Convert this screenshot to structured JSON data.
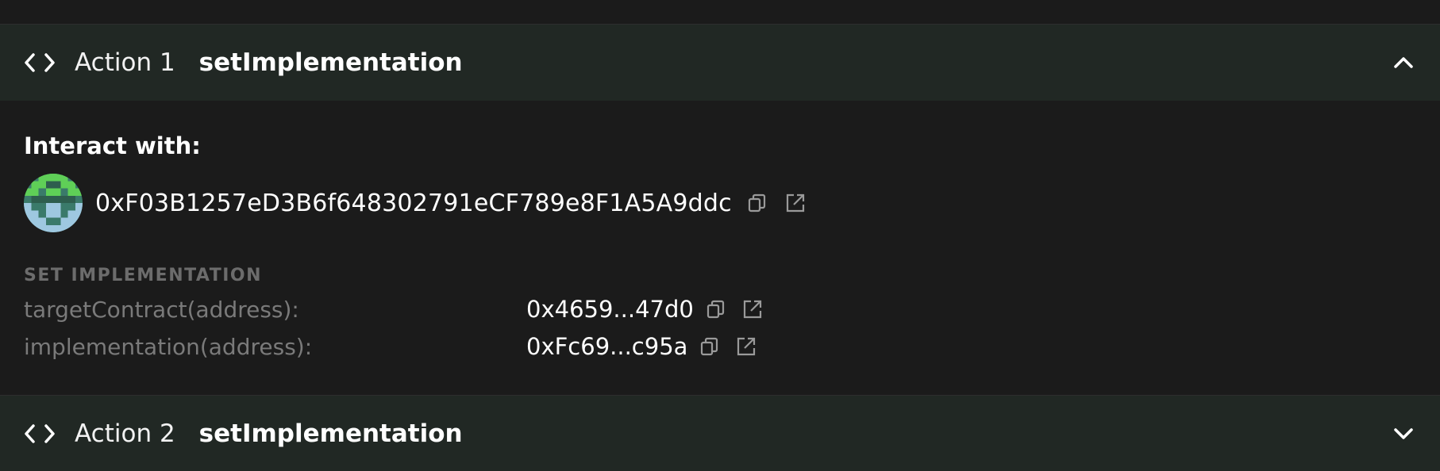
{
  "actions": [
    {
      "label": "Action 1",
      "method": "setImplementation"
    },
    {
      "label": "Action 2",
      "method": "setImplementation"
    }
  ],
  "interact": {
    "label": "Interact with:",
    "address": "0xF03B1257eD3B6f648302791eCF789e8F1A5A9ddc"
  },
  "section": {
    "title": "SET IMPLEMENTATION",
    "params": [
      {
        "name": "targetContract(address):",
        "value": "0x4659...47d0"
      },
      {
        "name": "implementation(address):",
        "value": "0xFc69...c95a"
      }
    ]
  },
  "icons": {
    "code": "code-brackets-icon",
    "collapse": "chevron-up-icon",
    "copy": "copy-icon",
    "external": "external-link-icon"
  },
  "colors": {
    "header_bg": "#212824",
    "body_bg": "#1b1b1b",
    "muted_text": "#7a7a7a",
    "section_title": "#6c6c6c",
    "avatar_green": "#5fcf57",
    "avatar_teal": "#3a7a6a",
    "avatar_blue": "#9ec8e0"
  }
}
